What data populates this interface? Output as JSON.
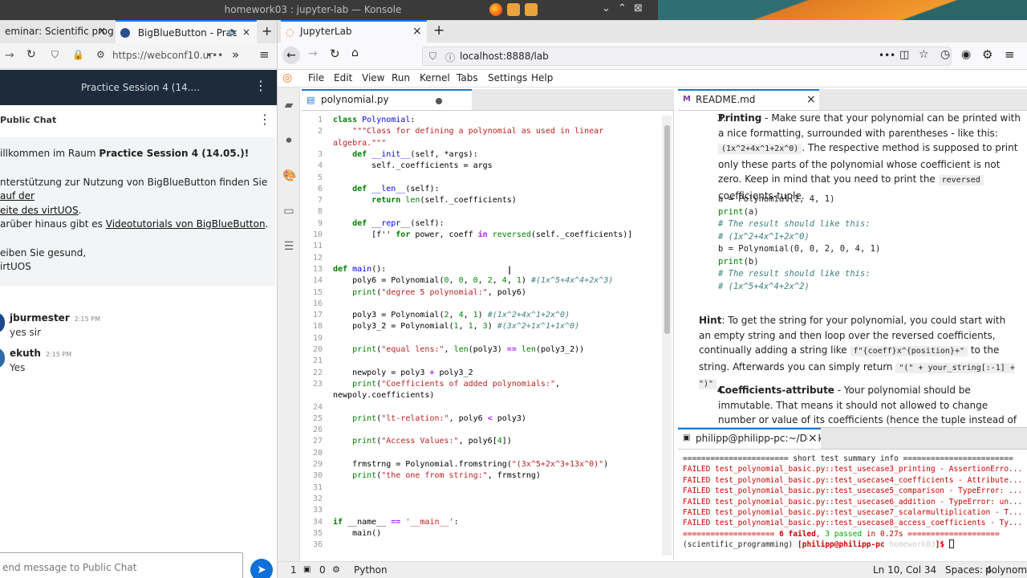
{
  "system": {
    "title": "homework03 : jupyter-lab — Konsole",
    "controls": [
      "⌄",
      "⌃",
      "⊠"
    ]
  },
  "left_browser": {
    "tabs": [
      {
        "label": "eminar: Scientific prog",
        "close": "×"
      },
      {
        "label": "BigBlueButton - Prac",
        "close": "×"
      }
    ],
    "new_tab": "+",
    "url": "https://webconf10.ur",
    "more": "•••",
    "session_title": "Practice Session 4 (14....",
    "chat": {
      "header": "Public Chat",
      "welcome": {
        "line1_prefix": "illkommen im Raum ",
        "line1_bold": "Practice Session 4 (14.05.)!",
        "line2": "nterstützung zur Nutzung von BigBlueButton finden Sie ",
        "link1": "auf der",
        "link1b": "eite des virtUOS",
        "line3_prefix": "arüber hinaus gibt es ",
        "link2": "Videotutorials von BigBlueButton",
        "line4": "eiben Sie gesund,",
        "line5": "irtUOS"
      },
      "messages": [
        {
          "name": "jburmester",
          "time": "2:15 PM",
          "text": "yes sir"
        },
        {
          "name": "ekuth",
          "time": "2:15 PM",
          "text": "Yes"
        }
      ],
      "input_placeholder": "end message to Public Chat",
      "send_icon": "➤"
    }
  },
  "right_browser": {
    "tab_label": "JupyterLab",
    "tab_close": "×",
    "new_tab": "+",
    "url": "localhost:8888/lab",
    "url_more": "•••"
  },
  "jupyter": {
    "menu": [
      "File",
      "Edit",
      "View",
      "Run",
      "Kernel",
      "Tabs",
      "Settings",
      "Help"
    ],
    "editor_tab": "polynomial.py",
    "code_lines": [
      {
        "n": "1",
        "html": "<span class='kw'>class</span> <span class='fn'>Polynomial</span>:"
      },
      {
        "n": "2",
        "html": "    <span class='st'>\"\"\"Class for defining a polynomial as used in linear</span>"
      },
      {
        "n": "",
        "html": "<span class='st'>algebra.\"\"\"</span>"
      },
      {
        "n": "3",
        "html": "    <span class='kw'>def</span> <span class='fn'>__init__</span>(self, *args):"
      },
      {
        "n": "4",
        "html": "        self._coefficients = args"
      },
      {
        "n": "5",
        "html": ""
      },
      {
        "n": "6",
        "html": "    <span class='kw'>def</span> <span class='fn'>__len__</span>(self):"
      },
      {
        "n": "7",
        "html": "        <span class='kw'>return</span> <span class='bi'>len</span>(self._coefficients)"
      },
      {
        "n": "8",
        "html": ""
      },
      {
        "n": "9",
        "html": "    <span class='kw'>def</span> <span class='fn'>__repr__</span>(self):"
      },
      {
        "n": "10",
        "html": "        [f'' <span class='kw'>for</span> power, coeff <span class='op'>in</span> <span class='bi'>reversed</span>(self._coefficients)]"
      },
      {
        "n": "11",
        "html": ""
      },
      {
        "n": "12",
        "html": ""
      },
      {
        "n": "13",
        "html": "<span class='kw'>def</span> <span class='fn'>main</span>():"
      },
      {
        "n": "14",
        "html": "    poly6 = Polynomial(<span class='num'>0</span>, <span class='num'>0</span>, <span class='num'>0</span>, <span class='num'>2</span>, <span class='num'>4</span>, <span class='num'>1</span>) <span class='cm'>#(1x^5+4x^4+2x^3)</span>"
      },
      {
        "n": "15",
        "html": "    <span class='bi'>print</span>(<span class='st'>\"degree 5 polynomial:\"</span>, poly6)"
      },
      {
        "n": "16",
        "html": ""
      },
      {
        "n": "17",
        "html": "    poly3 = Polynomial(<span class='num'>2</span>, <span class='num'>4</span>, <span class='num'>1</span>) <span class='cm'>#(1x^2+4x^1+2x^0)</span>"
      },
      {
        "n": "18",
        "html": "    poly3_2 = Polynomial(<span class='num'>1</span>, <span class='num'>1</span>, <span class='num'>3</span>) <span class='cm'>#(3x^2+1x^1+1x^0)</span>"
      },
      {
        "n": "19",
        "html": ""
      },
      {
        "n": "20",
        "html": "    <span class='bi'>print</span>(<span class='st'>\"equal lens:\"</span>, <span class='bi'>len</span>(poly3) <span class='op'>==</span> <span class='bi'>len</span>(poly3_2))"
      },
      {
        "n": "21",
        "html": ""
      },
      {
        "n": "22",
        "html": "    newpoly = poly3 <span class='op'>+</span> poly3_2"
      },
      {
        "n": "23",
        "html": "    <span class='bi'>print</span>(<span class='st'>\"Coefficients of added polynomials:\"</span>,"
      },
      {
        "n": "",
        "html": "newpoly.coefficients)"
      },
      {
        "n": "24",
        "html": ""
      },
      {
        "n": "25",
        "html": "    <span class='bi'>print</span>(<span class='st'>\"lt-relation:\"</span>, poly6 <span class='op'>&lt;</span> poly3)"
      },
      {
        "n": "26",
        "html": ""
      },
      {
        "n": "27",
        "html": "    <span class='bi'>print</span>(<span class='st'>\"Access Values:\"</span>, poly6[<span class='num'>4</span>])"
      },
      {
        "n": "28",
        "html": ""
      },
      {
        "n": "29",
        "html": "    frmstrng = Polynomial.fromstring(<span class='st'>\"(3x^5+2x^3+13x^0)\"</span>)"
      },
      {
        "n": "30",
        "html": "    <span class='bi'>print</span>(<span class='st'>\"the one from string:\"</span>, frmstrng)"
      },
      {
        "n": "31",
        "html": ""
      },
      {
        "n": "32",
        "html": ""
      },
      {
        "n": "33",
        "html": ""
      },
      {
        "n": "34",
        "html": "<span class='kw'>if</span> __name__ <span class='op'>==</span> <span class='st'>'__main__'</span>:"
      },
      {
        "n": "35",
        "html": "    main()"
      },
      {
        "n": "36",
        "html": ""
      }
    ],
    "readme_tab": "README.md",
    "readme": {
      "item3_num": "3.",
      "item3_title": "Printing",
      "item3_text1": " - Make sure that your polynomial can be printed with a nice formatting, surrounded with parentheses - like this: ",
      "item3_code1": "(1x^2+4x^1+2x^0)",
      "item3_text2": ". The respective method is supposed to print only these parts of the polynomial whose coefficient is not zero. Keep in mind that you need to print the ",
      "item3_code2": "reversed",
      "item3_text3": " coefficients-tuple.",
      "code_block": "a = Polynomial(2, 4, 1)\nprint(a)\n# The result should like this:\n# (1x^2+4x^1+2x^0)\nb = Polynomial(0, 0, 2, 0, 4, 1)\nprint(b)\n# The result should like this:\n# (1x^5+4x^4+2x^2)",
      "hint_title": "Hint",
      "hint_text1": ": To get the string for your polynomial, you could start with an empty string and then loop over the reversed coefficients, continually adding a string like ",
      "hint_code1": "f\"{coeff}x^{position}+\"",
      "hint_text2": " to the string. Afterwards you can simply return ",
      "hint_code2": "\"(\" + your_string[:-1] + \")\"",
      "item4_num": "4.",
      "item4_title": "Coefficients-attribute",
      "item4_text": " - Your polynomial should be immutable. That means it should not allowed to change number or value of its coefficients (hence the tuple instead of a list). Make sure that its"
    },
    "terminal_tab": "philipp@philipp-pc:~/Desktc",
    "terminal_lines": [
      {
        "cls": "",
        "text": "======================= short test summary info ========================"
      },
      {
        "cls": "red",
        "text": "FAILED test_polynomial_basic.py::test_usecase3_printing - AssertionErro..."
      },
      {
        "cls": "red",
        "text": "FAILED test_polynomial_basic.py::test_usecase4_coefficients - Attribute..."
      },
      {
        "cls": "red",
        "text": "FAILED test_polynomial_basic.py::test_usecase5_comparison - TypeError: ..."
      },
      {
        "cls": "red",
        "text": "FAILED test_polynomial_basic.py::test_usecase6_addition - TypeError: un..."
      },
      {
        "cls": "red",
        "text": "FAILED test_polynomial_basic.py::test_usecase7_scalarmultiplication - T..."
      },
      {
        "cls": "red",
        "text": "FAILED test_polynomial_basic.py::test_usecase8_access_coefficients - Ty..."
      }
    ],
    "terminal_summary": {
      "left": "==================== ",
      "failed": "6 failed",
      "sep": ", ",
      "passed": "3 passed",
      "time": " in 0.27s ",
      "right": "===================="
    },
    "terminal_prompt": {
      "env": "(scientific_programming) ",
      "user": "[philipp@philipp-pc ",
      "dir": "homework03",
      "end": "]$ "
    },
    "status": {
      "count1": "1",
      "count2": "0",
      "lang": "Python",
      "position": "Ln 10, Col 34",
      "spaces": "Spaces: 4",
      "file": "polynomia"
    }
  }
}
